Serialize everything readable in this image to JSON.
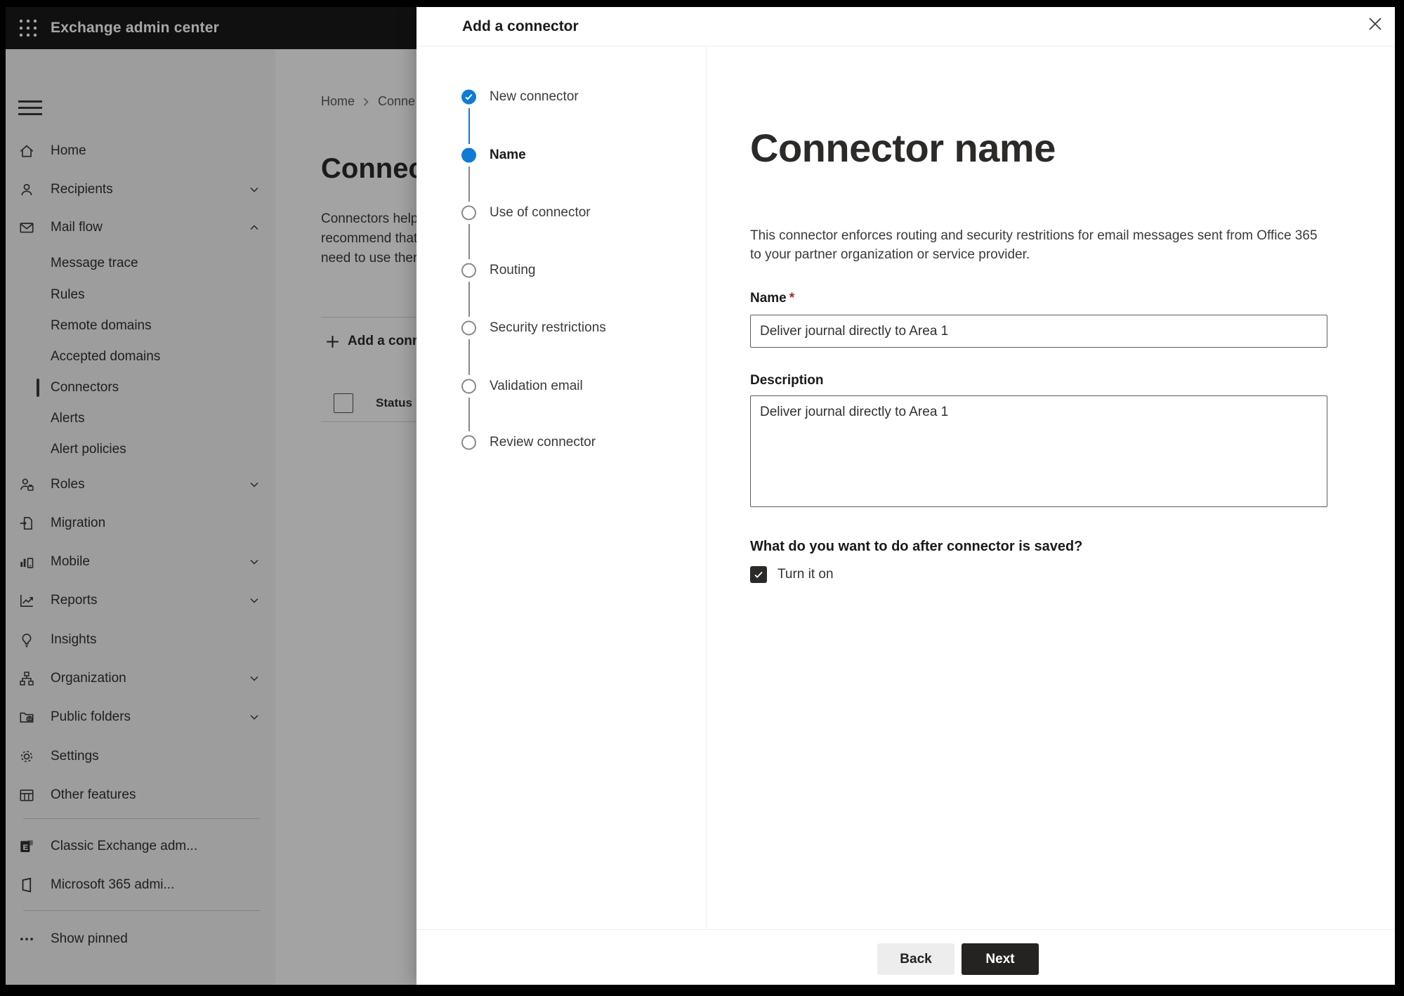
{
  "colors": {
    "accent_blue": "#0f7bd4",
    "required_red": "#a4262c",
    "header_bg": "#1b1a19",
    "next_button_bg": "#242322",
    "back_button_bg": "#ededed",
    "selected_indicator": "#3b3a39"
  },
  "header": {
    "title": "Exchange admin center",
    "waffle_icon": "app-launcher-icon"
  },
  "sidebar": {
    "hamburger_icon": "hamburger-menu-icon",
    "items": [
      {
        "label": "Home",
        "type": "main",
        "icon": "home-icon",
        "chevron": null,
        "selected": false
      },
      {
        "label": "Recipients",
        "type": "main",
        "icon": "people-icon",
        "chevron": "down",
        "selected": false
      },
      {
        "label": "Mail flow",
        "type": "main",
        "icon": "mail-icon",
        "chevron": "up",
        "selected": false
      },
      {
        "label": "Message trace",
        "type": "sub",
        "icon": null,
        "chevron": null,
        "selected": false
      },
      {
        "label": "Rules",
        "type": "sub",
        "icon": null,
        "chevron": null,
        "selected": false
      },
      {
        "label": "Remote domains",
        "type": "sub",
        "icon": null,
        "chevron": null,
        "selected": false
      },
      {
        "label": "Accepted domains",
        "type": "sub",
        "icon": null,
        "chevron": null,
        "selected": false
      },
      {
        "label": "Connectors",
        "type": "sub",
        "icon": null,
        "chevron": null,
        "selected": true
      },
      {
        "label": "Alerts",
        "type": "sub",
        "icon": null,
        "chevron": null,
        "selected": false
      },
      {
        "label": "Alert policies",
        "type": "sub",
        "icon": null,
        "chevron": null,
        "selected": false
      },
      {
        "label": "Roles",
        "type": "main",
        "icon": "roles-icon",
        "chevron": "down",
        "selected": false
      },
      {
        "label": "Migration",
        "type": "main",
        "icon": "migration-icon",
        "chevron": null,
        "selected": false
      },
      {
        "label": "Mobile",
        "type": "main",
        "icon": "mobile-icon",
        "chevron": "down",
        "selected": false
      },
      {
        "label": "Reports",
        "type": "main",
        "icon": "reports-icon",
        "chevron": "down",
        "selected": false
      },
      {
        "label": "Insights",
        "type": "main",
        "icon": "insights-icon",
        "chevron": null,
        "selected": false
      },
      {
        "label": "Organization",
        "type": "main",
        "icon": "organization-icon",
        "chevron": "down",
        "selected": false
      },
      {
        "label": "Public folders",
        "type": "main",
        "icon": "public-folders-icon",
        "chevron": "down",
        "selected": false
      },
      {
        "label": "Settings",
        "type": "main",
        "icon": "settings-icon",
        "chevron": null,
        "selected": false
      },
      {
        "label": "Other features",
        "type": "main",
        "icon": "other-features-icon",
        "chevron": null,
        "selected": false
      },
      {
        "label": "Classic Exchange adm...",
        "type": "main",
        "icon": "classic-exchange-icon",
        "chevron": null,
        "selected": false
      },
      {
        "label": "Microsoft 365 admi...",
        "type": "main",
        "icon": "microsoft-365-icon",
        "chevron": null,
        "selected": false
      },
      {
        "label": "Show pinned",
        "type": "main",
        "icon": "show-pinned-icon",
        "chevron": null,
        "selected": false
      }
    ]
  },
  "background_page": {
    "breadcrumb": {
      "home": "Home",
      "current": "Conne"
    },
    "title": "Connect",
    "intro_lines": "Connectors help\nrecommend that\nneed to use ther",
    "add_button_label": "Add a conn",
    "table": {
      "column_status": "Status"
    }
  },
  "dialog": {
    "title": "Add a connector",
    "close_icon": "close-icon",
    "steps": [
      {
        "label": "New connector",
        "state": "done"
      },
      {
        "label": "Name",
        "state": "active"
      },
      {
        "label": "Use of connector",
        "state": "todo"
      },
      {
        "label": "Routing",
        "state": "todo"
      },
      {
        "label": "Security restrictions",
        "state": "todo"
      },
      {
        "label": "Validation email",
        "state": "todo"
      },
      {
        "label": "Review connector",
        "state": "todo"
      }
    ],
    "content": {
      "heading": "Connector name",
      "description": "This connector enforces routing and security restritions for email messages sent from Office 365\nto your partner organization or service provider.",
      "name_label": "Name",
      "required_marker": "*",
      "name_value": "Deliver journal directly to Area 1",
      "description_label": "Description",
      "description_value": "Deliver journal directly to Area 1",
      "after_save_question": "What do you want to do after connector is saved?",
      "turn_on_label": "Turn it on",
      "turn_on_checked": true
    },
    "footer": {
      "back_label": "Back",
      "next_label": "Next"
    }
  }
}
